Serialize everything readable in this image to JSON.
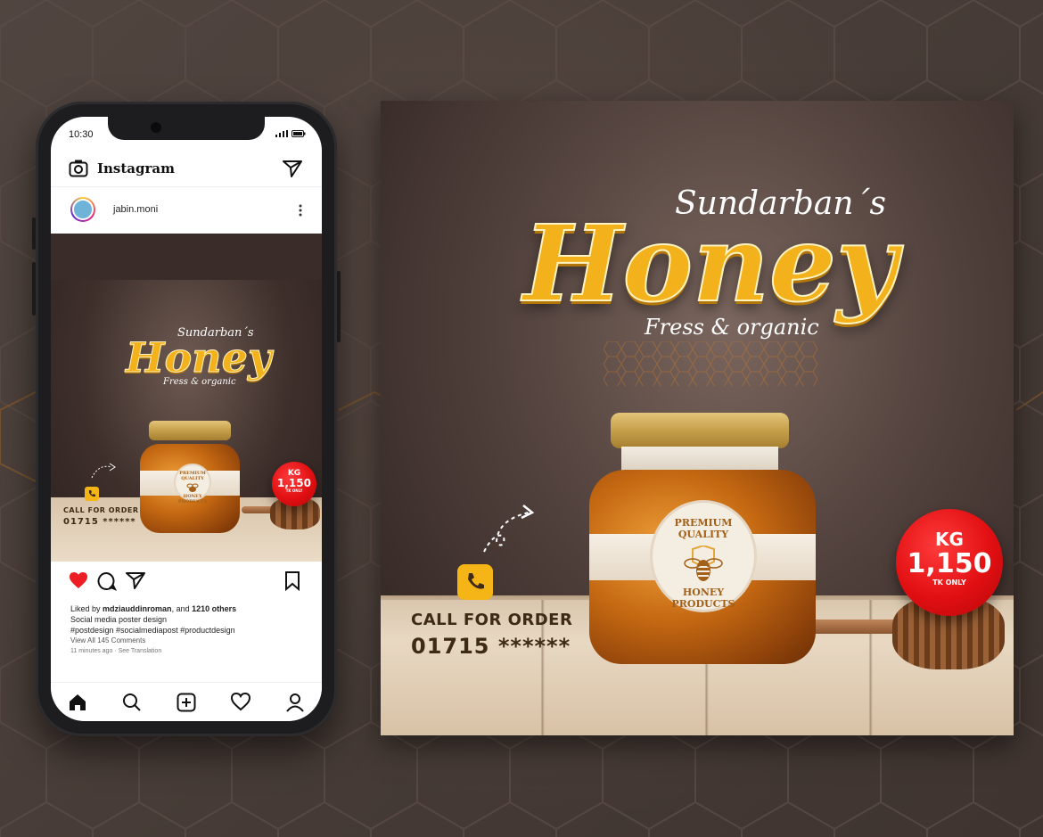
{
  "colors": {
    "honey": "#f3b11c",
    "badge_red": "#e10f12",
    "brown_text": "#3e2a15",
    "heart": "#ed1d24",
    "background": "#4a3d38"
  },
  "phone": {
    "status": {
      "time": "10:30"
    },
    "instagram": {
      "app_name": "Instagram",
      "username": "jabin.moni",
      "liked_prefix": "Liked by",
      "liked_user": "mdziauddinroman",
      "liked_mid": ", and",
      "liked_others": "1210 others",
      "caption": "Social media poster design",
      "hashtags": "#postdesign #socialmediapost #productdesign",
      "view_comments": "View All 145 Comments",
      "time_line": "11 minutes ago · See Translation",
      "icons": {
        "camera": "camera-icon",
        "send": "send-icon",
        "more": "more-vertical-icon",
        "like": "heart-icon",
        "comment": "comment-icon",
        "share": "share-icon",
        "save": "bookmark-icon",
        "home": "home-icon",
        "search": "search-icon",
        "add": "add-post-icon",
        "activity": "heart-outline-icon",
        "profile": "profile-icon"
      }
    }
  },
  "poster": {
    "brand_sub": "Sundarban´s",
    "brand_main": "Honey",
    "tagline": "Fress & organic",
    "call_label": "CALL FOR ORDER",
    "phone_number": "01715 ******",
    "price_unit": "KG",
    "price_value": "1,150",
    "price_note": "TK ONLY",
    "label_top": "PREMIUM QUALITY",
    "label_bottom": "HONEY PRODUCTS"
  }
}
